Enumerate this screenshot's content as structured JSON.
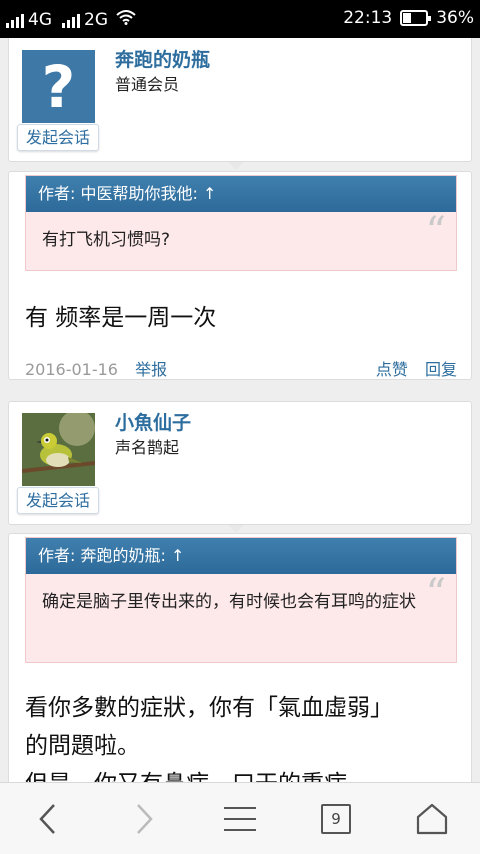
{
  "status_bar": {
    "network_1": "4G",
    "network_2": "2G",
    "time": "22:13",
    "battery": "36%",
    "battery_level": 0.36,
    "icons": [
      "signal-icon",
      "signal-icon",
      "wifi-icon",
      "battery-icon"
    ]
  },
  "posts": [
    {
      "author": {
        "name": "奔跑的奶瓶",
        "role": "普通会员",
        "avatar": "question-avatar-icon",
        "chat_label": "发起会话"
      },
      "quote": {
        "header": "作者: 中医帮助你我他: ↑",
        "text": "有打飞机习惯吗?"
      },
      "body": "有 频率是一周一次",
      "date": "2016-01-16",
      "report": "举报",
      "like": "点赞",
      "reply": "回复"
    },
    {
      "author": {
        "name": "小魚仙子",
        "role": "声名鹊起",
        "avatar": "bird-photo",
        "chat_label": "发起会话"
      },
      "quote": {
        "header": "作者: 奔跑的奶瓶: ↑",
        "text": "确定是脑子里传出来的，有时候也会有耳鸣的症状"
      },
      "body_line1": "看你多數的症狀，你有「氣血虛弱」",
      "body_line2": "的問題啦。",
      "body_line3": "但是，你又有鼻病，口干的重病"
    }
  ],
  "bottom_nav": {
    "tab_count": "9",
    "icons": [
      "back-icon",
      "forward-icon",
      "menu-icon",
      "tabs-icon",
      "home-icon"
    ]
  }
}
